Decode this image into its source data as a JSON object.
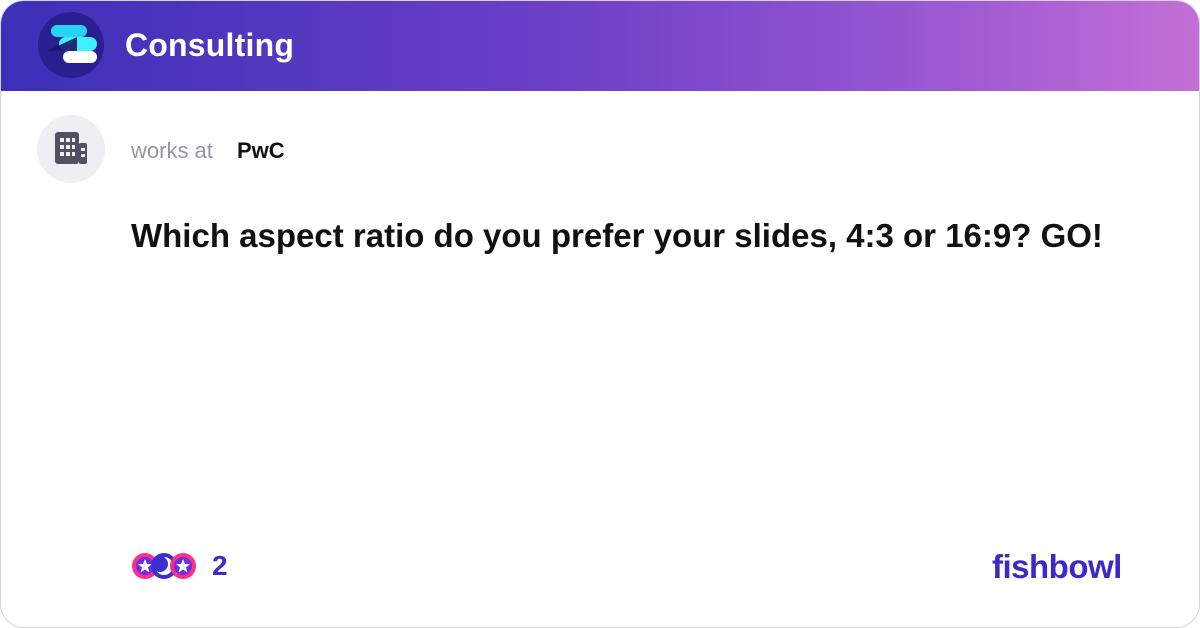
{
  "header": {
    "title": "Consulting",
    "logo_icon": "fishbowl-bowl-icon"
  },
  "post": {
    "author_prefix": "works at",
    "company": "PwC",
    "avatar_icon": "building-icon",
    "text": "Which aspect ratio do you prefer your slides, 4:3 or 16:9? GO!"
  },
  "footer": {
    "reaction_count": "2",
    "reaction_icons": [
      "star-reaction-icon",
      "moon-reaction-icon",
      "star-reaction-icon"
    ],
    "brand": "fishbowl"
  },
  "colors": {
    "header_gradient_start": "#3c2fb8",
    "header_gradient_end": "#c46fd7",
    "brand": "#3b2ac8",
    "muted_text": "#9794a6"
  }
}
